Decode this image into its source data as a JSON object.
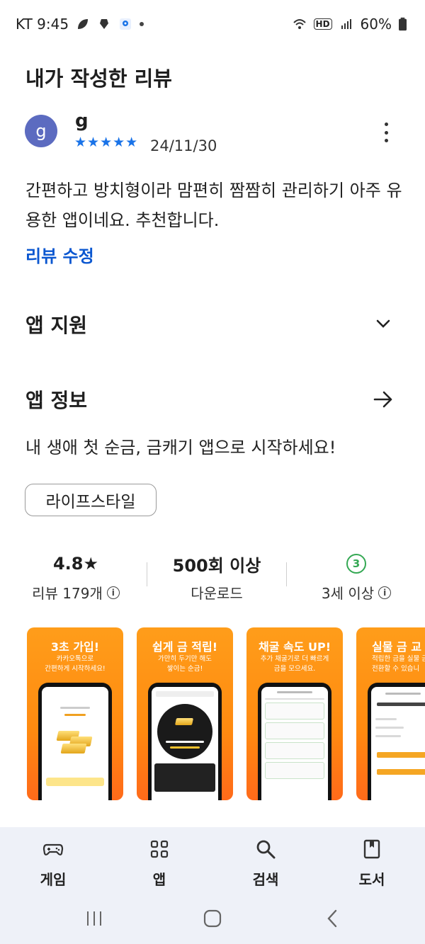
{
  "status_bar": {
    "carrier_time": "KT 9:45",
    "battery": "60%",
    "hd_label": "HD"
  },
  "my_review": {
    "section_title": "내가 작성한 리뷰",
    "avatar_letter": "g",
    "reviewer_name": "g",
    "rating_stars": 5,
    "stars_text": "★★★★★",
    "date": "24/11/30",
    "text": "간편하고 방치형이라 맘편히 짬짬히 관리하기 아주 유용한 앱이네요. 추천합니다.",
    "edit_label": "리뷰 수정"
  },
  "app_support": {
    "title": "앱 지원"
  },
  "app_info": {
    "title": "앱 정보",
    "description": "내 생애 첫 순금, 금캐기 앱으로 시작하세요!",
    "category_chip": "라이프스타일"
  },
  "stats": {
    "rating_value": "4.8★",
    "rating_label": "리뷰 179개",
    "downloads_value": "500회 이상",
    "downloads_label": "다운로드",
    "age_badge": "3",
    "age_label": "3세 이상"
  },
  "screenshots": [
    {
      "title": "3초 가입!",
      "subtitle": "카카오톡으로\n간편하게 시작하세요!"
    },
    {
      "title": "쉽게 금 적립!",
      "subtitle": "가만히 두기만 해도\n쌓이는 순금!"
    },
    {
      "title": "채굴 속도 UP!",
      "subtitle": "추가 채굴기로 더 빠르게\n금을 모으세요."
    },
    {
      "title": "실물 금 교",
      "subtitle": "적립한 금을 실물 금\n전환할 수 있습니"
    }
  ],
  "bottom_nav": [
    {
      "label": "게임",
      "icon": "gamepad-icon"
    },
    {
      "label": "앱",
      "icon": "apps-grid-icon"
    },
    {
      "label": "검색",
      "icon": "search-icon"
    },
    {
      "label": "도서",
      "icon": "book-icon"
    }
  ],
  "colors": {
    "accent_blue": "#0b57d0",
    "star_blue": "#1a73e8",
    "age_green": "#34a853",
    "nav_bg": "#eef1f8",
    "shot_orange": "#ff9d1a"
  }
}
